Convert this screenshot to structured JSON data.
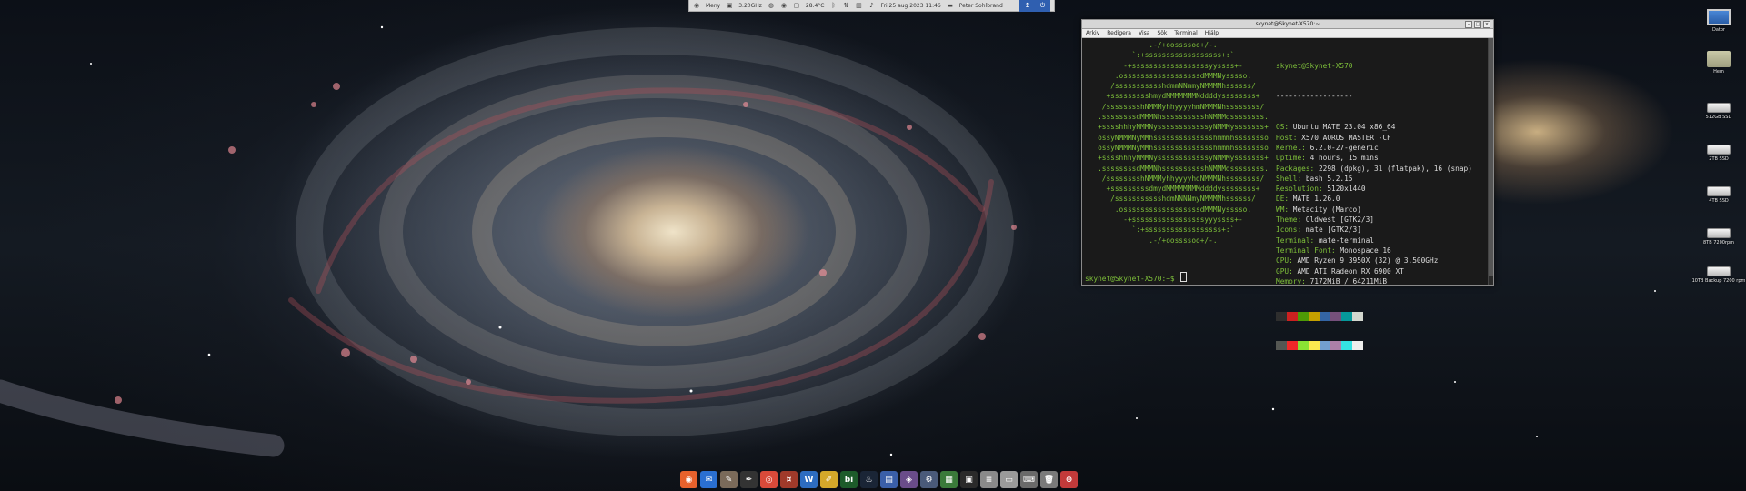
{
  "top_panel": {
    "menu_label": "Meny",
    "cpu_freq": "3.20GHz",
    "temperature": "28.4°C",
    "datetime": "Fri 25 aug 2023 11:46",
    "user": "Peter Sohlbrand",
    "icons": [
      "menu-icon",
      "cpu-icon",
      "sensor-icon",
      "network-icon",
      "battery-icon",
      "bluetooth-icon",
      "chart-icon",
      "calendar-icon",
      "user-icon"
    ]
  },
  "terminal": {
    "title": "skynet@Skynet-X570:~",
    "menu": [
      "Arkiv",
      "Redigera",
      "Visa",
      "Sök",
      "Terminal",
      "Hjälp"
    ],
    "logo_lines": [
      "               .-/+oossssoo+/-.",
      "           `:+ssssssssssssssssss+:`",
      "         -+ssssssssssssssssssyyssss+-",
      "       .ossssssssssssssssssdMMMNysssso.",
      "      /ssssssssssshdmmNNmmyNMMMMhssssss/",
      "     +ssssssssshmydMMMMMMMNddddyssssssss+",
      "    /sssssssshNMMMyhhyyyyhmNMMMNhssssssss/",
      "   .ssssssssdMMMNhsssssssssshNMMMdssssssss.",
      "   +sssshhhyNMMNyssssssssssssyNMMMysssssss+",
      "   ossyNMMMNyMMhsssssssssssssshmmmhssssssso",
      "   ossyNMMMNyMMhsssssssssssssshmmmhssssssso",
      "   +sssshhhyNMMNyssssssssssssyNMMMysssssss+",
      "   .ssssssssdMMMNhsssssssssshNMMMdssssssss.",
      "    /sssssssshNMMMyhhyyyyhdNMMMNhssssssss/",
      "     +sssssssssdmydMMMMMMMMddddyssssssss+",
      "      /ssssssssssshdmNNNNmyNMMMMhssssss/",
      "       .ossssssssssssssssssdMMMNysssso.",
      "         -+sssssssssssssssssyyyssss+-",
      "           `:+ssssssssssssssssss+:`",
      "               .-/+oossssoo+/-."
    ],
    "user_host": "skynet@Skynet-X570",
    "separator": "------------------",
    "info": [
      {
        "key": "OS",
        "value": "Ubuntu MATE 23.04 x86_64"
      },
      {
        "key": "Host",
        "value": "X570 AORUS MASTER -CF"
      },
      {
        "key": "Kernel",
        "value": "6.2.0-27-generic"
      },
      {
        "key": "Uptime",
        "value": "4 hours, 15 mins"
      },
      {
        "key": "Packages",
        "value": "2298 (dpkg), 31 (flatpak), 16 (snap)"
      },
      {
        "key": "Shell",
        "value": "bash 5.2.15"
      },
      {
        "key": "Resolution",
        "value": "5120x1440"
      },
      {
        "key": "DE",
        "value": "MATE 1.26.0"
      },
      {
        "key": "WM",
        "value": "Metacity (Marco)"
      },
      {
        "key": "Theme",
        "value": "Oldwest [GTK2/3]"
      },
      {
        "key": "Icons",
        "value": "mate [GTK2/3]"
      },
      {
        "key": "Terminal",
        "value": "mate-terminal"
      },
      {
        "key": "Terminal Font",
        "value": "Monospace 16"
      },
      {
        "key": "CPU",
        "value": "AMD Ryzen 9 3950X (32) @ 3.500GHz"
      },
      {
        "key": "GPU",
        "value": "AMD ATI Radeon RX 6900 XT"
      },
      {
        "key": "Memory",
        "value": "7172MiB / 64211MiB"
      }
    ],
    "palette": [
      "#2e2e2e",
      "#cc2020",
      "#4e9a06",
      "#c4a000",
      "#3465a4",
      "#75507b",
      "#06989a",
      "#d3d7cf"
    ],
    "palette_bright": [
      "#555753",
      "#ef2929",
      "#8ae234",
      "#fce94f",
      "#729fcf",
      "#ad7fa8",
      "#34e2e2",
      "#eeeeec"
    ],
    "prompt": "skynet@Skynet-X570:~$ "
  },
  "desktop_icons": [
    {
      "name": "computer",
      "label": "Dator",
      "icon": "monitor"
    },
    {
      "name": "home",
      "label": "Hem",
      "icon": "folder"
    },
    {
      "name": "512gb-ssd",
      "label": "512GB SSD",
      "icon": "drive"
    },
    {
      "name": "2tb-ssd",
      "label": "2TB SSD",
      "icon": "drive"
    },
    {
      "name": "4tb-ssd",
      "label": "4TB SSD",
      "icon": "drive"
    },
    {
      "name": "8tb-7200rpm",
      "label": "8TB 7200rpm",
      "icon": "drive"
    },
    {
      "name": "10tb-backup",
      "label": "10TB Backup 7200 rpm",
      "icon": "drive"
    }
  ],
  "dock": [
    {
      "name": "firefox",
      "icon": "firefox-icon",
      "color": "#e8622c",
      "glyph": "◉"
    },
    {
      "name": "thunderbird",
      "icon": "thunderbird-icon",
      "color": "#2a6fd1",
      "glyph": "✉"
    },
    {
      "name": "gimp",
      "icon": "gimp-icon",
      "color": "#7a6a5a",
      "glyph": "✎"
    },
    {
      "name": "inkscape",
      "icon": "inkscape-icon",
      "color": "#333333",
      "glyph": "✒"
    },
    {
      "name": "chrome",
      "icon": "chrome-icon",
      "color": "#d94a3a",
      "glyph": "◎"
    },
    {
      "name": "gnucash",
      "icon": "gnucash-icon",
      "color": "#a03a2a",
      "glyph": "¤"
    },
    {
      "name": "writer",
      "icon": "document-icon",
      "color": "#2d6cc0",
      "glyph": "W"
    },
    {
      "name": "editor",
      "icon": "editor-icon",
      "color": "#d4a82a",
      "glyph": "✐"
    },
    {
      "name": "bi",
      "icon": "bi-icon",
      "color": "#1d5b2a",
      "glyph": "bi"
    },
    {
      "name": "steam",
      "icon": "steam-icon",
      "color": "#1a2536",
      "glyph": "♨"
    },
    {
      "name": "files",
      "icon": "files-icon",
      "color": "#3a5fa8",
      "glyph": "▤"
    },
    {
      "name": "tor",
      "icon": "tor-icon",
      "color": "#6a4c8a",
      "glyph": "◈"
    },
    {
      "name": "settings",
      "icon": "settings-icon",
      "color": "#4a5a7a",
      "glyph": "⚙"
    },
    {
      "name": "calculator",
      "icon": "calculator-icon",
      "color": "#3a7a3a",
      "glyph": "▦"
    },
    {
      "name": "terminal",
      "icon": "terminal-icon",
      "color": "#2a2a2a",
      "glyph": "▣"
    },
    {
      "name": "text-editor",
      "icon": "text-editor-icon",
      "color": "#8a8a8a",
      "glyph": "≡"
    },
    {
      "name": "file-manager",
      "icon": "folder-icon",
      "color": "#9a9a9a",
      "glyph": "▭"
    },
    {
      "name": "keyboard",
      "icon": "keyboard-icon",
      "color": "#6a6a6a",
      "glyph": "⌨"
    },
    {
      "name": "trash",
      "icon": "trash-icon",
      "color": "#7a7a7a",
      "glyph": "🗑"
    },
    {
      "name": "software-center",
      "icon": "bag-icon",
      "color": "#c23a3a",
      "glyph": "⊕"
    }
  ]
}
